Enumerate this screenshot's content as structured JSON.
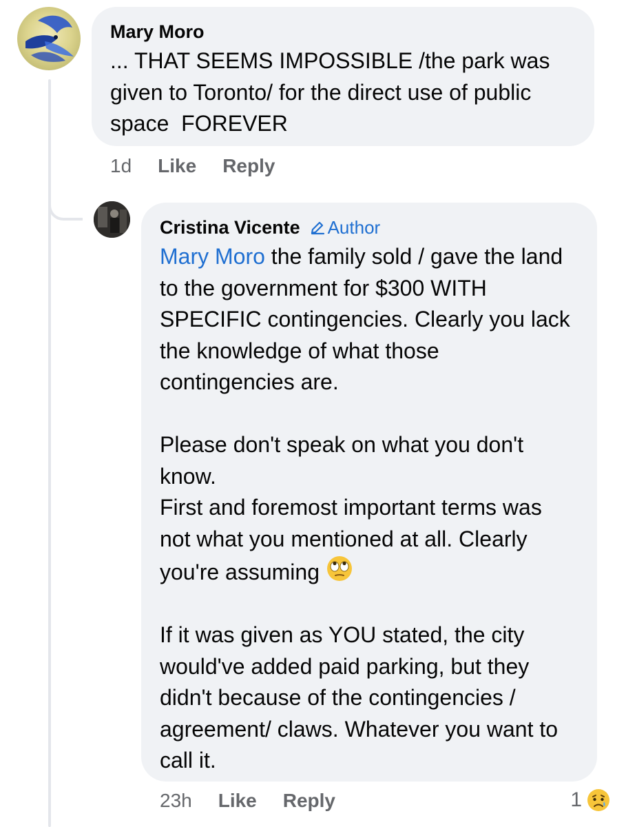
{
  "comments": [
    {
      "author": "Mary Moro",
      "text": "... THAT SEEMS IMPOSSIBLE /the park was given to Toronto/ for the direct use of public space  FOREVER",
      "time": "1d",
      "like_label": "Like",
      "reply_label": "Reply"
    },
    {
      "author": "Cristina Vicente",
      "badge": "Author",
      "mention": "Mary Moro",
      "text_after_mention": " the family sold / gave the land to the government for $300 WITH SPECIFIC contingencies. Clearly you lack the knowledge of what those contingencies are.\n\nPlease don't speak on what you don't know.\nFirst and foremost important terms was not what you mentioned at all. Clearly you're assuming ",
      "text_end": "\n\nIf it was given as YOU stated, the city would've added paid parking, but they didn't because of the contingencies / agreement/ claws. Whatever you want to call it.",
      "inline_emoji": "face-with-rolling-eyes",
      "time": "23h",
      "like_label": "Like",
      "reply_label": "Reply",
      "reaction_count": "1",
      "reaction_icon": "sad-reaction-icon"
    }
  ],
  "colors": {
    "bubble": "#f0f2f5",
    "link": "#1f6fd1",
    "meta": "#65676b",
    "thread_line": "#e4e6eb"
  }
}
